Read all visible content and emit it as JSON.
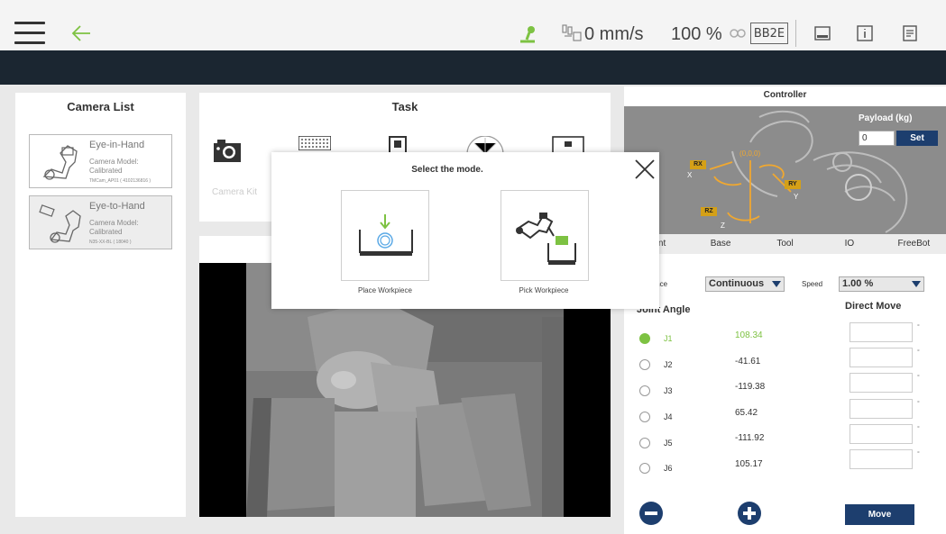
{
  "topbar": {
    "speed": "0 mm/s",
    "percent": "100 %",
    "controller_label": "BB2E"
  },
  "camera_list": {
    "title": "Camera List",
    "cameras": [
      {
        "name": "Eye-in-Hand",
        "model_label": "Camera Model:",
        "status": "Calibrated",
        "id": "TMCam_AP01 ( 4102136816 )"
      },
      {
        "name": "Eye-to-Hand",
        "model_label": "Camera Model:",
        "status": "Calibrated",
        "id": "N35-XX-BL ( 18040 )"
      }
    ]
  },
  "task": {
    "title": "Task",
    "camera_kit_label": "Camera Kit"
  },
  "modal": {
    "title": "Select the mode.",
    "options": [
      {
        "label": "Place Workpiece"
      },
      {
        "label": "Pick Workpiece"
      }
    ]
  },
  "controller": {
    "title": "Controller",
    "payload_label": "Payload (kg)",
    "payload_value": "0",
    "set_label": "Set",
    "axis_labels": {
      "rx": "RX",
      "ry": "RY",
      "rz": "RZ",
      "x": "X",
      "y": "Y",
      "z": "Z",
      "origin": "(0,0,0)"
    },
    "tabs": [
      "Joint",
      "Base",
      "Tool",
      "IO",
      "FreeBot"
    ],
    "distance_label": "Distance",
    "distance_value": "Continuous",
    "speed_label": "Speed",
    "speed_value": "1.00 %",
    "joint_angle_label": "Joint Angle",
    "direct_move_label": "Direct Move",
    "joints": [
      {
        "name": "J1",
        "value": "108.34"
      },
      {
        "name": "J2",
        "value": "-41.61"
      },
      {
        "name": "J3",
        "value": "-119.38"
      },
      {
        "name": "J4",
        "value": "65.42"
      },
      {
        "name": "J5",
        "value": "-111.92"
      },
      {
        "name": "J6",
        "value": "105.17"
      }
    ],
    "move_label": "Move"
  },
  "colors": {
    "accent_green": "#7dc242",
    "navy": "#1d3e6e",
    "dark_bar": "#1b2631"
  }
}
